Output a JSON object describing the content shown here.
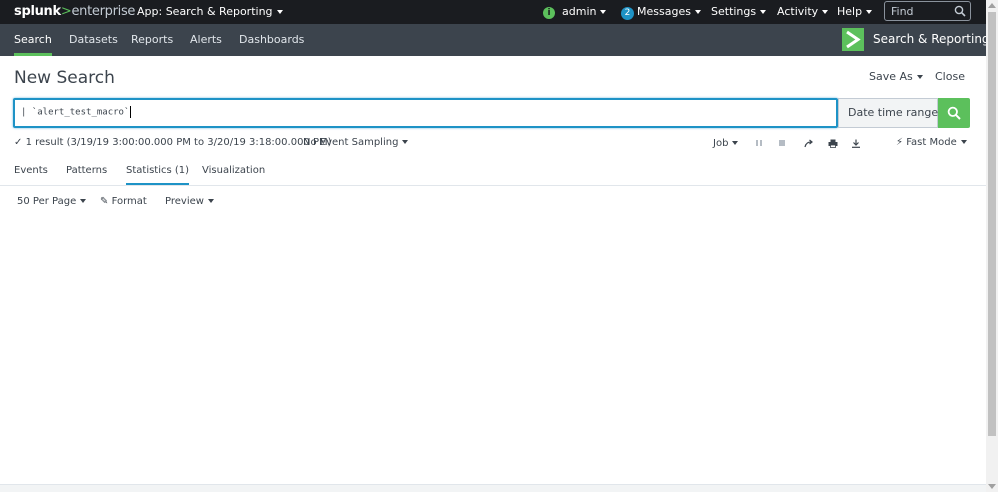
{
  "topbar": {
    "logo": {
      "splunk": "splunk",
      "gt": ">",
      "enterprise": "enterprise"
    },
    "app_menu": "App: Search & Reporting",
    "user": "admin",
    "messages_count": "2",
    "messages": "Messages",
    "settings": "Settings",
    "activity": "Activity",
    "help": "Help",
    "find_placeholder": "Find"
  },
  "appbar": {
    "tabs": [
      {
        "label": "Search",
        "active": true
      },
      {
        "label": "Datasets"
      },
      {
        "label": "Reports"
      },
      {
        "label": "Alerts"
      },
      {
        "label": "Dashboards"
      }
    ],
    "app_title": "Search & Reporting",
    "accent": "#5cc05c"
  },
  "page": {
    "title": "New Search",
    "save_as": "Save As",
    "close": "Close"
  },
  "search": {
    "query": "| `alert_test_macro`",
    "time_range": "Date time range"
  },
  "status": {
    "result": "1 result (3/19/19 3:00:00.000 PM to 3/20/19 3:18:00.000 PM)",
    "sampling": "No Event Sampling",
    "job": "Job",
    "mode": "Fast Mode"
  },
  "result_tabs": [
    {
      "label": "Events"
    },
    {
      "label": "Patterns"
    },
    {
      "label": "Statistics (1)",
      "active": true
    },
    {
      "label": "Visualization"
    }
  ],
  "options": {
    "per_page": "50 Per Page",
    "format": "Format",
    "preview": "Preview"
  }
}
